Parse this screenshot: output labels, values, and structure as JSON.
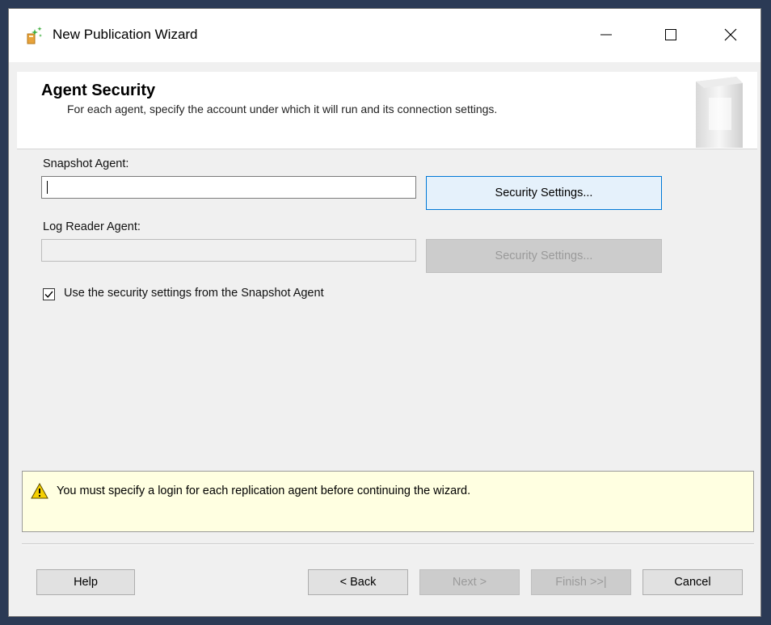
{
  "window": {
    "title": "New Publication Wizard",
    "controls": {
      "minimize": "minimize",
      "maximize": "maximize",
      "close": "close"
    }
  },
  "header": {
    "title": "Agent Security",
    "subtitle": "For each agent, specify the account under which it will run and its connection settings."
  },
  "snapshot_agent": {
    "label": "Snapshot Agent:",
    "value": "",
    "button_label": "Security Settings..."
  },
  "log_reader_agent": {
    "label": "Log Reader Agent:",
    "value": "",
    "button_label": "Security Settings..."
  },
  "use_snapshot_settings": {
    "label": "Use the security settings from the Snapshot Agent",
    "checked": true
  },
  "warning": {
    "text": "You must specify a login for each replication agent before continuing the wizard.",
    "icon": "warning-icon"
  },
  "footer": {
    "help": "Help",
    "back": "< Back",
    "next": "Next >",
    "finish": "Finish >>|",
    "cancel": "Cancel"
  },
  "colors": {
    "focus_border": "#0078d7",
    "warning_bg": "#ffffe1",
    "dialog_bg": "#f0f0f0"
  }
}
